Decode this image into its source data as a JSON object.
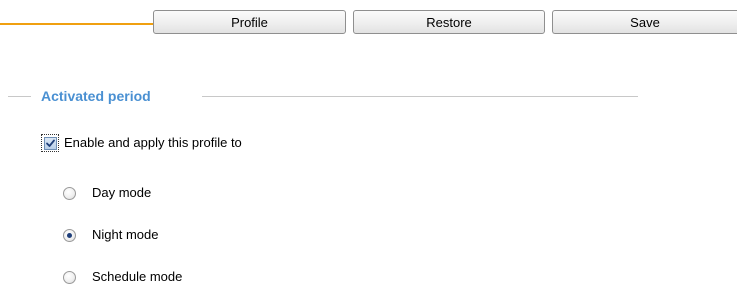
{
  "toolbar": {
    "profile_label": "Profile",
    "restore_label": "Restore",
    "save_label": "Save"
  },
  "section": {
    "title": "Activated period"
  },
  "enable": {
    "label": "Enable and apply this profile to",
    "checked": true
  },
  "modes": [
    {
      "label": "Day mode",
      "selected": false
    },
    {
      "label": "Night mode",
      "selected": true
    },
    {
      "label": "Schedule mode",
      "selected": false
    }
  ],
  "colors": {
    "accent_line": "#f0a010",
    "section_title": "#4a90d2"
  }
}
